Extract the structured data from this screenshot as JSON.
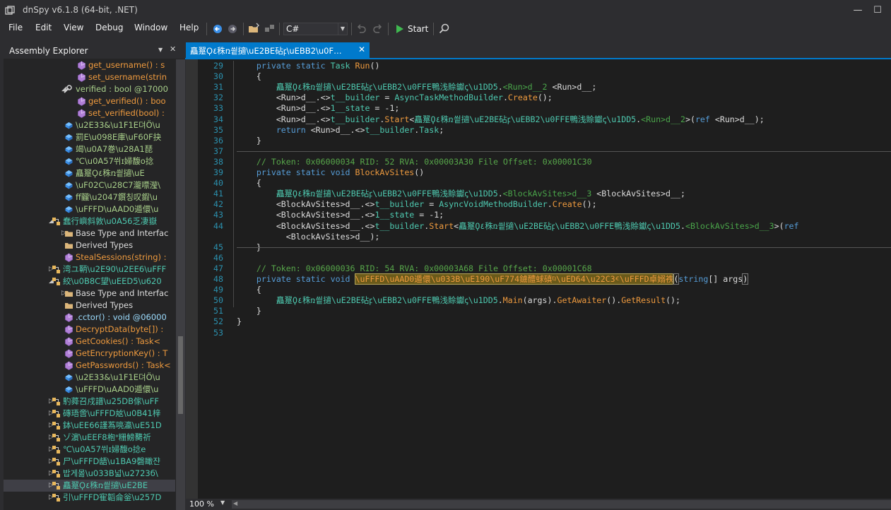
{
  "window": {
    "title": "dnSpy v6.1.8 (64-bit, .NET)",
    "min": "—",
    "max": "☐",
    "close": "✕"
  },
  "menu": [
    "File",
    "Edit",
    "View",
    "Debug",
    "Window",
    "Help"
  ],
  "toolbar": {
    "language": "C#",
    "start_label": "Start"
  },
  "explorer": {
    "title": "Assembly Explorer",
    "rows": [
      {
        "label": "get_username() : s",
        "kind": "method",
        "indent": 118,
        "icon": "method-icon",
        "exp": ""
      },
      {
        "label": "set_username(strin",
        "kind": "method",
        "indent": 118,
        "icon": "method-icon",
        "exp": ""
      },
      {
        "label": "verified : bool @17000",
        "kind": "prop",
        "indent": 100,
        "icon": "property-icon",
        "exp": "◢"
      },
      {
        "label": "get_verified() : boo",
        "kind": "method",
        "indent": 118,
        "icon": "method-icon",
        "exp": ""
      },
      {
        "label": "set_verified(bool) :",
        "kind": "method",
        "indent": 118,
        "icon": "method-icon",
        "exp": ""
      },
      {
        "label": "\\u2E33&\\u1F1E뎌Ö\\u",
        "kind": "field",
        "indent": 100,
        "icon": "field-icon",
        "exp": ""
      },
      {
        "label": "罰E\\u098E庫\\uF60F抉",
        "kind": "field",
        "indent": 100,
        "icon": "field-icon",
        "exp": ""
      },
      {
        "label": "竭\\u0A7巻\\u28A1琵",
        "kind": "field",
        "indent": 100,
        "icon": "field-icon",
        "exp": ""
      },
      {
        "label": "℃\\u0A57쒸ɪ婦馥o捻",
        "kind": "field",
        "indent": 100,
        "icon": "field-icon",
        "exp": ""
      },
      {
        "label": "矗翨Ϙ٤秼ռ씥擿\\uE",
        "kind": "field",
        "indent": 100,
        "icon": "field-icon",
        "exp": ""
      },
      {
        "label": "\\uF02C\\u28C7瀧嘌瀅\\",
        "kind": "field",
        "indent": 100,
        "icon": "field-icon",
        "exp": ""
      },
      {
        "label": "ff龖\\u2047鑦칭叹鍜\\u",
        "kind": "field",
        "indent": 100,
        "icon": "field-icon",
        "exp": ""
      },
      {
        "label": "\\uFFFD\\uAAD0遁儇\\u",
        "kind": "field",
        "indent": 100,
        "icon": "field-icon",
        "exp": ""
      },
      {
        "label": "蠢行嶼斜敦\\u0A56乏凄嶽",
        "kind": "ns",
        "indent": 82,
        "icon": "class-icon",
        "exp": "◢"
      },
      {
        "label": "Base Type and Interfac",
        "kind": "white",
        "indent": 100,
        "icon": "folder-icon",
        "exp": "▷"
      },
      {
        "label": "Derived Types",
        "kind": "white",
        "indent": 100,
        "icon": "folder-icon",
        "exp": ""
      },
      {
        "label": "StealSessions(string) :",
        "kind": "method",
        "indent": 100,
        "icon": "method-icon",
        "exp": ""
      },
      {
        "label": "湾ユ鞆\\u2E90\\u2EE6\\uFFF",
        "kind": "ns",
        "indent": 82,
        "icon": "class-icon",
        "exp": "▷"
      },
      {
        "label": "絞\\u0B8C望\\uEED5\\u620",
        "kind": "ns",
        "indent": 82,
        "icon": "class-icon",
        "exp": "◢"
      },
      {
        "label": "Base Type and Interfac",
        "kind": "white",
        "indent": 100,
        "icon": "folder-icon",
        "exp": "▷"
      },
      {
        "label": "Derived Types",
        "kind": "white",
        "indent": 100,
        "icon": "folder-icon",
        "exp": ""
      },
      {
        "label": ".cctor() : void @06000",
        "kind": "dim",
        "indent": 100,
        "icon": "method-icon",
        "exp": ""
      },
      {
        "label": "DecryptData(byte[]) :",
        "kind": "method",
        "indent": 100,
        "icon": "method-icon",
        "exp": ""
      },
      {
        "label": "GetCookies() : Task<",
        "kind": "method",
        "indent": 100,
        "icon": "method-icon",
        "exp": ""
      },
      {
        "label": "GetEncryptionKey() : T",
        "kind": "method",
        "indent": 100,
        "icon": "method-icon",
        "exp": ""
      },
      {
        "label": "GetPasswords() : Task<",
        "kind": "method",
        "indent": 100,
        "icon": "method-icon",
        "exp": ""
      },
      {
        "label": "\\u2E33&\\u1F1E뎌Ö\\u",
        "kind": "field",
        "indent": 100,
        "icon": "field-icon",
        "exp": ""
      },
      {
        "label": "\\uFFFD\\uAAD0遁儇\\u",
        "kind": "field",
        "indent": 100,
        "icon": "field-icon",
        "exp": ""
      },
      {
        "label": "馰蕣召戍譜\\u25DB傢\\uFF",
        "kind": "ns",
        "indent": 82,
        "icon": "class-icon",
        "exp": "▷"
      },
      {
        "label": "磚珸啻\\uFFFD奿\\u0B41梓",
        "kind": "ns",
        "indent": 82,
        "icon": "class-icon",
        "exp": "▷"
      },
      {
        "label": "鉢\\uEE66謹蒍喨瀛\\uE51D",
        "kind": "ns",
        "indent": 82,
        "icon": "class-icon",
        "exp": "▷"
      },
      {
        "label": "ゾ濵\\uEEF8枹ᐤ粣鰟臡祈",
        "kind": "ns",
        "indent": 82,
        "icon": "class-icon",
        "exp": "▷"
      },
      {
        "label": "℃\\u0A57쒸ɪ婦馥o捻e",
        "kind": "ns",
        "indent": 82,
        "icon": "class-icon",
        "exp": "▷"
      },
      {
        "label": "尸\\uFFFD龉\\u1BA9磬瞰쟌",
        "kind": "ns",
        "indent": 82,
        "icon": "class-icon",
        "exp": "▷"
      },
      {
        "label": "밥게몲\\u033B넓\\u2723б\\",
        "kind": "ns",
        "indent": 82,
        "icon": "class-icon",
        "exp": "▷"
      },
      {
        "label": "矗翨Ϙ٤秼ռ씥擿\\uE2BE",
        "kind": "ns",
        "indent": 82,
        "icon": "class-icon",
        "exp": "▷"
      },
      {
        "label": "引\\uFFFD寉韜侖釡\\u257D",
        "kind": "ns",
        "indent": 82,
        "icon": "class-icon",
        "exp": "▷"
      }
    ]
  },
  "tab": {
    "label": "矗翨Ϙ٤秼ռ씥擿\\uE2BE砧ꝼ\\uEBB2\\u0F…",
    "close": "✕"
  },
  "code": {
    "lines": [
      {
        "n": "29",
        "indent": 4,
        "toks": [
          [
            "kw",
            "private static "
          ],
          [
            "t",
            "Task "
          ],
          [
            "m",
            "Run"
          ],
          [
            "id",
            "()"
          ]
        ]
      },
      {
        "n": "30",
        "indent": 4,
        "toks": [
          [
            "id",
            "{"
          ]
        ]
      },
      {
        "n": "31",
        "indent": 8,
        "toks": [
          [
            "t",
            "矗翨Ϙ٤秼ռ씥擿\\uE2BE砧ꝼ\\uEBB2\\u0FFE鴨浅賒钀ꞔ\\u1DD5"
          ],
          [
            "id",
            "."
          ],
          [
            "g",
            "<Run>d__2"
          ],
          [
            "id",
            " <Run>d__;"
          ]
        ]
      },
      {
        "n": "32",
        "indent": 8,
        "toks": [
          [
            "id",
            "<Run>d__.<>"
          ],
          [
            "t",
            "t__builder"
          ],
          [
            "id",
            " = "
          ],
          [
            "t",
            "AsyncTaskMethodBuilder"
          ],
          [
            "id",
            "."
          ],
          [
            "m",
            "Create"
          ],
          [
            "id",
            "();"
          ]
        ]
      },
      {
        "n": "33",
        "indent": 8,
        "toks": [
          [
            "id",
            "<Run>d__.<>"
          ],
          [
            "t",
            "1__state"
          ],
          [
            "id",
            " = -1;"
          ]
        ]
      },
      {
        "n": "34",
        "indent": 8,
        "toks": [
          [
            "id",
            "<Run>d__.<>"
          ],
          [
            "t",
            "t__builder"
          ],
          [
            "id",
            "."
          ],
          [
            "m",
            "Start"
          ],
          [
            "id",
            "<"
          ],
          [
            "t",
            "矗翨Ϙ٤秼ռ씥擿\\uE2BE砧ꝼ\\uEBB2\\u0FFE鴨浅賒钀ꞔ\\u1DD5"
          ],
          [
            "id",
            "."
          ],
          [
            "g",
            "<Run>d__2"
          ],
          [
            "id",
            ">("
          ],
          [
            "kw",
            "ref"
          ],
          [
            "id",
            " <Run>d__);"
          ]
        ]
      },
      {
        "n": "35",
        "indent": 8,
        "toks": [
          [
            "kw",
            "return "
          ],
          [
            "id",
            "<Run>d__.<>"
          ],
          [
            "t",
            "t__builder"
          ],
          [
            "id",
            "."
          ],
          [
            "t",
            "Task"
          ],
          [
            "id",
            ";"
          ]
        ]
      },
      {
        "n": "36",
        "indent": 4,
        "toks": [
          [
            "id",
            "}"
          ]
        ]
      },
      {
        "n": "37",
        "indent": 0,
        "toks": []
      },
      {
        "n": "38",
        "indent": 4,
        "toks": [
          [
            "c",
            "// Token: 0x06000034 RID: 52 RVA: 0x00003A30 File Offset: 0x00001C30"
          ]
        ]
      },
      {
        "n": "39",
        "indent": 4,
        "toks": [
          [
            "kw",
            "private static void "
          ],
          [
            "m",
            "BlockAvSites"
          ],
          [
            "id",
            "()"
          ]
        ]
      },
      {
        "n": "40",
        "indent": 4,
        "toks": [
          [
            "id",
            "{"
          ]
        ]
      },
      {
        "n": "41",
        "indent": 8,
        "toks": [
          [
            "t",
            "矗翨Ϙ٤秼ռ씥擿\\uE2BE砧ꝼ\\uEBB2\\u0FFE鴨浅賒钀ꞔ\\u1DD5"
          ],
          [
            "id",
            "."
          ],
          [
            "g",
            "<BlockAvSites>d__3"
          ],
          [
            "id",
            " <BlockAvSites>d__;"
          ]
        ]
      },
      {
        "n": "42",
        "indent": 8,
        "toks": [
          [
            "id",
            "<BlockAvSites>d__.<>"
          ],
          [
            "t",
            "t__builder"
          ],
          [
            "id",
            " = "
          ],
          [
            "t",
            "AsyncVoidMethodBuilder"
          ],
          [
            "id",
            "."
          ],
          [
            "m",
            "Create"
          ],
          [
            "id",
            "();"
          ]
        ]
      },
      {
        "n": "43",
        "indent": 8,
        "toks": [
          [
            "id",
            "<BlockAvSites>d__.<>"
          ],
          [
            "t",
            "1__state"
          ],
          [
            "id",
            " = -1;"
          ]
        ]
      },
      {
        "n": "44",
        "indent": 8,
        "toks": [
          [
            "id",
            "<BlockAvSites>d__.<>"
          ],
          [
            "t",
            "t__builder"
          ],
          [
            "id",
            "."
          ],
          [
            "m",
            "Start"
          ],
          [
            "id",
            "<"
          ],
          [
            "t",
            "矗翨Ϙ٤秼ռ씥擿\\uE2BE砧ꝼ\\uEBB2\\u0FFE鴨浅賒钀ꞔ\\u1DD5"
          ],
          [
            "id",
            "."
          ],
          [
            "g",
            "<BlockAvSites>d__3"
          ],
          [
            "id",
            ">("
          ],
          [
            "kw",
            "ref"
          ]
        ]
      },
      {
        "n": "",
        "indent": 10,
        "toks": [
          [
            "id",
            "<BlockAvSites>d__);"
          ]
        ]
      },
      {
        "n": "45",
        "indent": 4,
        "toks": [
          [
            "id",
            "}"
          ]
        ]
      },
      {
        "n": "46",
        "indent": 0,
        "toks": []
      },
      {
        "n": "47",
        "indent": 4,
        "toks": [
          [
            "c",
            "// Token: 0x06000036 RID: 54 RVA: 0x00003A68 File Offset: 0x00001C68"
          ]
        ]
      },
      {
        "n": "48",
        "indent": 4,
        "toks": [
          [
            "kw",
            "private static void "
          ],
          [
            "hl",
            "\\uFFFD\\uAAD0遁儇\\u033B\\uE190\\uF774鐪醴蛷磌ⱒ\\uED64\\u22C3ⱔ\\uFFFD卓嫋祑"
          ],
          [
            "br",
            "("
          ],
          [
            "kw",
            "string"
          ],
          [
            "id",
            "[] args"
          ],
          [
            "br",
            ")"
          ]
        ]
      },
      {
        "n": "49",
        "indent": 4,
        "toks": [
          [
            "id",
            "{"
          ]
        ]
      },
      {
        "n": "50",
        "indent": 8,
        "toks": [
          [
            "t",
            "矗翨Ϙ٤秼ռ씥擿\\uE2BE砧ꝼ\\uEBB2\\u0FFE鴨浅賒钀ꞔ\\u1DD5"
          ],
          [
            "id",
            "."
          ],
          [
            "m",
            "Main"
          ],
          [
            "id",
            "(args)."
          ],
          [
            "m",
            "GetAwaiter"
          ],
          [
            "id",
            "()."
          ],
          [
            "m",
            "GetResult"
          ],
          [
            "id",
            "();"
          ]
        ]
      },
      {
        "n": "51",
        "indent": 4,
        "toks": [
          [
            "id",
            "}"
          ]
        ]
      },
      {
        "n": "52",
        "indent": 0,
        "toks": [
          [
            "id",
            "}"
          ]
        ]
      },
      {
        "n": "53",
        "indent": 0,
        "toks": []
      }
    ]
  },
  "status": {
    "zoom": "100 %"
  }
}
